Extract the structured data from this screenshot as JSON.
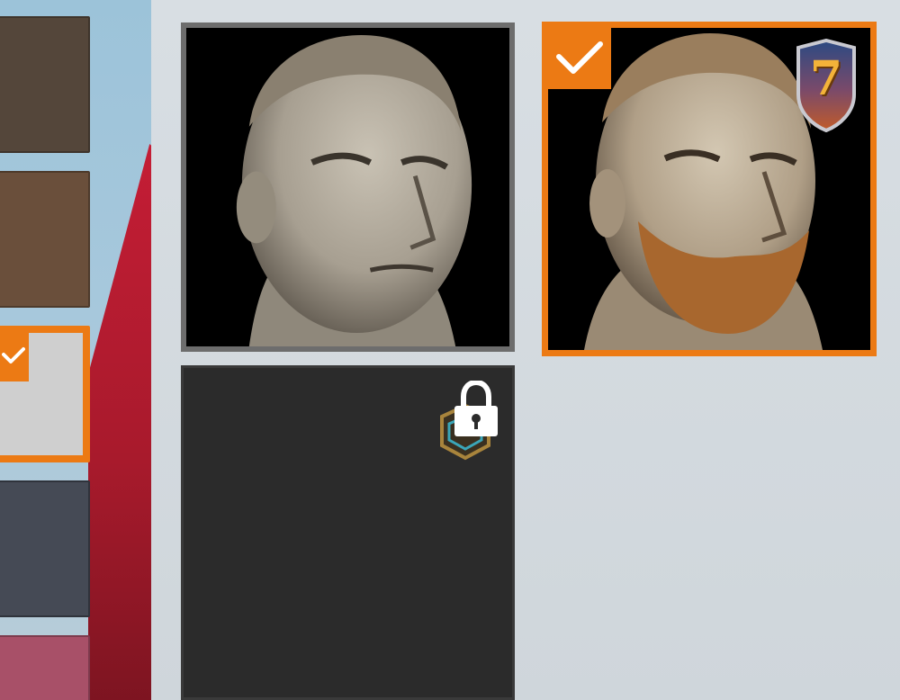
{
  "left_swatches": {
    "items": [
      {
        "color": "#54463a",
        "selected": false
      },
      {
        "color": "#6a4f3b",
        "selected": false
      },
      {
        "color": "#cfcfcf",
        "selected": true
      },
      {
        "color": "#454a55",
        "selected": false
      },
      {
        "color": "#a85068",
        "selected": false
      }
    ],
    "accent": "#ec7a14"
  },
  "face_grid": {
    "cards": [
      {
        "style": "clean-shaven",
        "selected": false,
        "locked": false
      },
      {
        "style": "beard",
        "selected": true,
        "locked": false,
        "level_badge": "7"
      },
      {
        "style": "locked",
        "selected": false,
        "locked": true
      }
    ]
  }
}
